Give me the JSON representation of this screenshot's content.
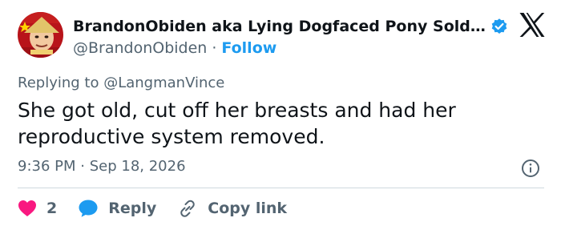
{
  "author": {
    "display_name": "BrandonObiden aka Lying Dogfaced Pony Sold…",
    "handle": "@BrandonObiden",
    "separator": "·",
    "follow_label": "Follow",
    "verified": true
  },
  "icons": {
    "avatar": "avatar-image",
    "verified": "verified-badge-icon",
    "logo": "x-logo-icon",
    "info": "info-icon",
    "like": "heart-icon",
    "reply": "reply-bubble-icon",
    "copy": "link-icon"
  },
  "tweet": {
    "reply_prefix": "Replying to ",
    "reply_to": "@LangmanVince",
    "text": "She got old, cut off her breasts and had her reproductive system removed.",
    "time": "9:36 PM",
    "time_separator": "·",
    "date": "Sep 18, 2026"
  },
  "actions": {
    "likes": "2",
    "reply_label": "Reply",
    "copy_label": "Copy link"
  },
  "colors": {
    "accent": "#1d9bf0",
    "like": "#f91880",
    "text": "#0f1419",
    "muted": "#536471",
    "divider": "#cfd9de"
  }
}
